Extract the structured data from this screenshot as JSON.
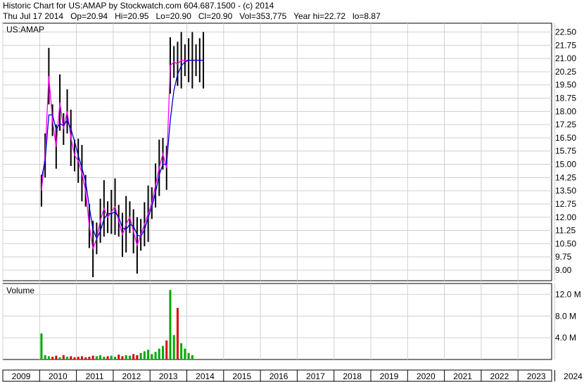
{
  "header": {
    "line1": "Historic Chart for US:AMAP by Stockwatch.com 604.687.1500 - (c) 2014",
    "line2": "Thu Jul 17 2014   Op=20.94   Hi=20.95   Lo=20.90   Cl=20.90   Vol=353,775   Year hi=22.72   lo=8.87"
  },
  "colors": {
    "grid": "#d0d0d0",
    "price_bar": "#000000",
    "ma_short": "#ff00ff",
    "ma_long": "#0000cc",
    "vol_up": "#00aa00",
    "vol_down": "#dd0000"
  },
  "chart_data": [
    {
      "type": "line",
      "title": "US:AMAP",
      "ylim": [
        8.4,
        23.0
      ],
      "yticks": [
        "22.50",
        "21.75",
        "21.00",
        "20.25",
        "19.50",
        "18.75",
        "18.00",
        "17.25",
        "16.50",
        "15.75",
        "15.00",
        "14.25",
        "13.50",
        "12.75",
        "12.00",
        "11.25",
        "10.50",
        "9.75",
        "9.00"
      ],
      "x_range": [
        2009.0,
        2024.5
      ],
      "x": [
        2010.05,
        2010.15,
        2010.25,
        2010.35,
        2010.45,
        2010.55,
        2010.65,
        2010.75,
        2010.85,
        2010.95,
        2011.05,
        2011.15,
        2011.25,
        2011.35,
        2011.45,
        2011.55,
        2011.65,
        2011.75,
        2011.85,
        2011.95,
        2012.05,
        2012.15,
        2012.25,
        2012.35,
        2012.45,
        2012.55,
        2012.65,
        2012.75,
        2012.85,
        2012.95,
        2013.05,
        2013.15,
        2013.25,
        2013.35,
        2013.45,
        2013.55,
        2013.65,
        2013.75,
        2013.85,
        2013.95,
        2014.05,
        2014.15,
        2014.25,
        2014.35,
        2014.45
      ],
      "series": [
        {
          "values": [
            13.5,
            15.5,
            20.0,
            17.5,
            16.0,
            18.5,
            17.0,
            18.0,
            16.5,
            15.5,
            15.2,
            14.5,
            13.5,
            11.5,
            10.2,
            10.8,
            11.8,
            12.5,
            12.0,
            12.3,
            12.6,
            11.8,
            11.0,
            11.6,
            12.0,
            11.2,
            10.4,
            11.0,
            11.6,
            12.2,
            12.8,
            13.8,
            14.8,
            15.6,
            14.8,
            20.6,
            20.8,
            20.7,
            20.9,
            20.9,
            20.9,
            20.9,
            20.9,
            20.9,
            20.9
          ]
        },
        {
          "values": [
            14.2,
            15.2,
            17.8,
            17.8,
            17.0,
            17.3,
            17.2,
            17.5,
            17.0,
            16.3,
            15.5,
            14.8,
            14.0,
            12.6,
            11.3,
            10.8,
            11.2,
            11.9,
            12.2,
            12.2,
            12.3,
            12.0,
            11.4,
            11.3,
            11.6,
            11.5,
            11.0,
            10.9,
            11.3,
            12.0,
            12.6,
            13.4,
            14.4,
            15.0,
            15.0,
            17.5,
            19.2,
            20.1,
            20.6,
            20.8,
            20.9,
            20.9,
            20.9,
            20.9,
            20.9
          ]
        }
      ]
    },
    {
      "type": "bar",
      "title": "Volume",
      "ylim": [
        0,
        14
      ],
      "yticks": [
        "12.0 M",
        "8.0 M",
        "4.0 M"
      ],
      "x": [
        2010.05,
        2010.15,
        2010.25,
        2010.35,
        2010.45,
        2010.55,
        2010.65,
        2010.75,
        2010.85,
        2010.95,
        2011.05,
        2011.15,
        2011.25,
        2011.35,
        2011.45,
        2011.55,
        2011.65,
        2011.75,
        2011.85,
        2011.95,
        2012.05,
        2012.15,
        2012.25,
        2012.35,
        2012.45,
        2012.55,
        2012.65,
        2012.75,
        2012.85,
        2012.95,
        2013.05,
        2013.15,
        2013.25,
        2013.35,
        2013.45,
        2013.55,
        2013.65,
        2013.75,
        2013.85,
        2013.95,
        2014.05,
        2014.15
      ],
      "values": [
        4.8,
        0.8,
        0.6,
        0.5,
        0.7,
        0.4,
        0.8,
        0.5,
        0.6,
        0.4,
        0.5,
        0.6,
        0.4,
        0.5,
        0.7,
        0.6,
        0.8,
        0.5,
        0.6,
        0.7,
        0.5,
        0.9,
        0.6,
        0.8,
        0.7,
        1.0,
        0.8,
        1.2,
        1.5,
        1.8,
        1.0,
        1.4,
        2.0,
        2.5,
        3.5,
        12.8,
        4.5,
        9.5,
        3.0,
        2.0,
        1.2,
        0.8
      ]
    }
  ],
  "x_axis": {
    "year_labels": [
      "2009",
      "2010",
      "2011",
      "2012",
      "2013",
      "2014",
      "2015",
      "2016",
      "2017",
      "2018",
      "2019",
      "2020",
      "2021",
      "2022",
      "2023",
      "2024"
    ]
  }
}
